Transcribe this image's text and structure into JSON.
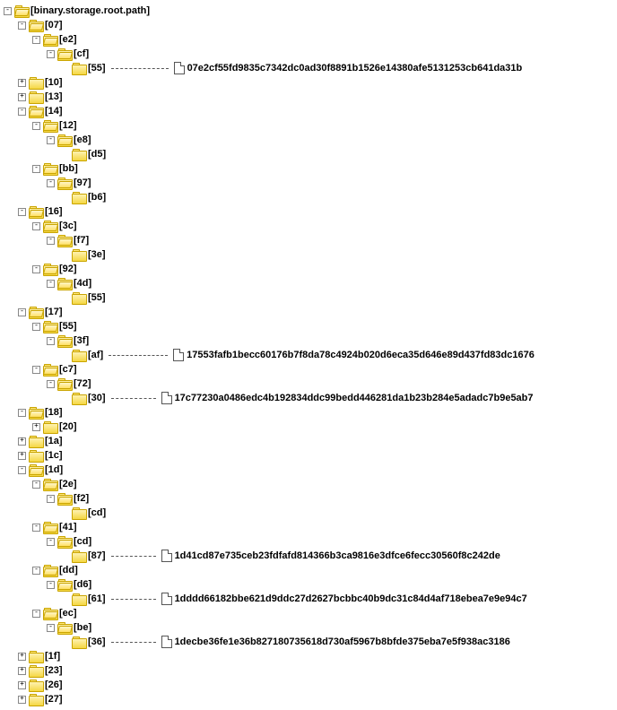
{
  "root_label": "[binary.storage.root.path]",
  "toggle": {
    "plus": "+",
    "minus": "-"
  },
  "tree": [
    {
      "l": "[07]",
      "op": true,
      "c": [
        {
          "l": "[e2]",
          "op": true,
          "c": [
            {
              "l": "[cf]",
              "op": true,
              "c": [
                {
                  "l": "[55]",
                  "leaf": true,
                  "hash": "07e2cf55fd9835c7342dc0ad30f8891b1526e14380afe5131253cb641da31b",
                  "dash": 64
                }
              ]
            }
          ]
        }
      ]
    },
    {
      "l": "[10]",
      "op": false
    },
    {
      "l": "[13]",
      "op": false
    },
    {
      "l": "[14]",
      "op": true,
      "c": [
        {
          "l": "[12]",
          "op": true,
          "c": [
            {
              "l": "[e8]",
              "op": true,
              "c": [
                {
                  "l": "[d5]",
                  "leaf": true
                }
              ]
            }
          ]
        },
        {
          "l": "[bb]",
          "op": true,
          "c": [
            {
              "l": "[97]",
              "op": true,
              "c": [
                {
                  "l": "[b6]",
                  "leaf": true
                }
              ]
            }
          ]
        }
      ]
    },
    {
      "l": "[16]",
      "op": true,
      "c": [
        {
          "l": "[3c]",
          "op": true,
          "c": [
            {
              "l": "[f7]",
              "op": true,
              "c": [
                {
                  "l": "[3e]",
                  "leaf": true
                }
              ]
            }
          ]
        },
        {
          "l": "[92]",
          "op": true,
          "c": [
            {
              "l": "[4d]",
              "op": true,
              "c": [
                {
                  "l": "[55]",
                  "leaf": true
                }
              ]
            }
          ]
        }
      ]
    },
    {
      "l": "[17]",
      "op": true,
      "c": [
        {
          "l": "[55]",
          "op": true,
          "c": [
            {
              "l": "[3f]",
              "op": true,
              "c": [
                {
                  "l": "[af]",
                  "leaf": true,
                  "hash": "17553fafb1becc60176b7f8da78c4924b020d6eca35d646e89d437fd83dc1676",
                  "dash": 66
                }
              ]
            }
          ]
        },
        {
          "l": "[c7]",
          "op": true,
          "c": [
            {
              "l": "[72]",
              "op": true,
              "c": [
                {
                  "l": "[30]",
                  "leaf": true,
                  "hash": "17c77230a0486edc4b192834ddc99bedd446281da1b23b284e5adadc7b9e5ab7",
                  "dash": 50
                }
              ]
            }
          ]
        }
      ]
    },
    {
      "l": "[18]",
      "op": true,
      "c": [
        {
          "l": "[20]",
          "op": false
        }
      ]
    },
    {
      "l": "[1a]",
      "op": false
    },
    {
      "l": "[1c]",
      "op": false
    },
    {
      "l": "[1d]",
      "op": true,
      "c": [
        {
          "l": "[2e]",
          "op": true,
          "c": [
            {
              "l": "[f2]",
              "op": true,
              "c": [
                {
                  "l": "[cd]",
                  "leaf": true
                }
              ]
            }
          ]
        },
        {
          "l": "[41]",
          "op": true,
          "c": [
            {
              "l": "[cd]",
              "op": true,
              "c": [
                {
                  "l": "[87]",
                  "leaf": true,
                  "hash": "1d41cd87e735ceb23fdfafd814366b3ca9816e3dfce6fecc30560f8c242de",
                  "dash": 50
                }
              ]
            }
          ]
        },
        {
          "l": "[dd]",
          "op": true,
          "c": [
            {
              "l": "[d6]",
              "op": true,
              "c": [
                {
                  "l": "[61]",
                  "leaf": true,
                  "hash": "1dddd66182bbe621d9ddc27d2627bcbbc40b9dc31c84d4af718ebea7e9e94c7",
                  "dash": 50
                }
              ]
            }
          ]
        },
        {
          "l": "[ec]",
          "op": true,
          "c": [
            {
              "l": "[be]",
              "op": true,
              "c": [
                {
                  "l": "[36]",
                  "leaf": true,
                  "hash": "1decbe36fe1e36b827180735618d730af5967b8bfde375eba7e5f938ac3186",
                  "dash": 50
                }
              ]
            }
          ]
        }
      ]
    },
    {
      "l": "[1f]",
      "op": false
    },
    {
      "l": "[23]",
      "op": false
    },
    {
      "l": "[26]",
      "op": false
    },
    {
      "l": "[27]",
      "op": false
    }
  ]
}
